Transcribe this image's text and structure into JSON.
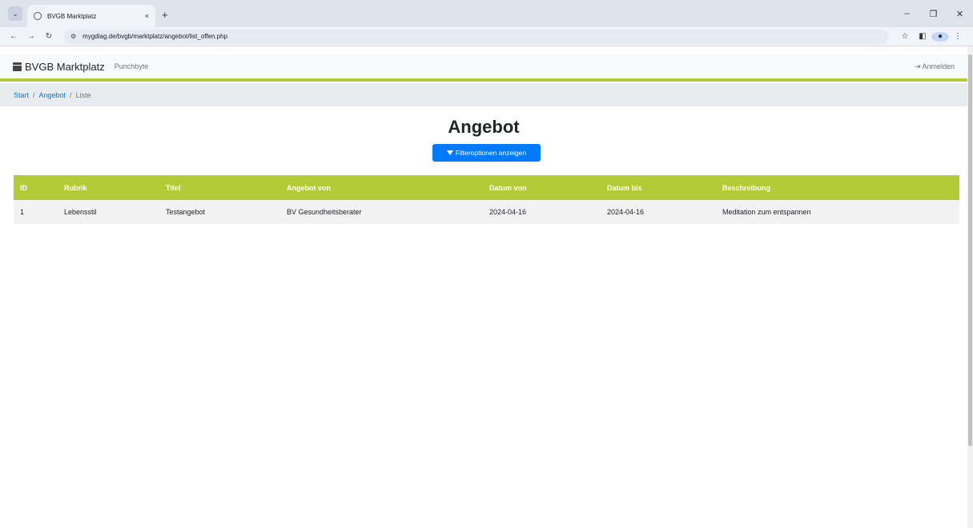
{
  "browser": {
    "tab_title": "BVGB Marktplatz",
    "tab_close": "×",
    "new_tab": "+",
    "url": "mygdiag.de/bvgb/marktplatz/angebot/list_offen.php",
    "window_controls": [
      "–",
      "❐",
      "✕"
    ]
  },
  "navbar": {
    "brand": "BVGB Marktplatz",
    "subbrand": "Punchbyte",
    "login": "Anmelden"
  },
  "breadcrumb": {
    "items": [
      "Start",
      "Angebot"
    ],
    "active": "Liste"
  },
  "page": {
    "title": "Angebot",
    "filter_button": "Filteroptionen anzeigen"
  },
  "table": {
    "headers": [
      "ID",
      "Rubrik",
      "Titel",
      "Angebot von",
      "Datum von",
      "Datum bis",
      "Beschreibung"
    ],
    "rows": [
      [
        "1",
        "Lebensstil",
        "Testangebot",
        "BV Gesundheitsberater",
        "2024-04-16",
        "2024-04-16",
        "Meditation zum entspannen"
      ]
    ]
  },
  "colors": {
    "accent": "#b3cb37",
    "primary": "#007bff",
    "breadcrumb_bg": "#e9ecef",
    "row_bg": "#f2f2f2"
  }
}
